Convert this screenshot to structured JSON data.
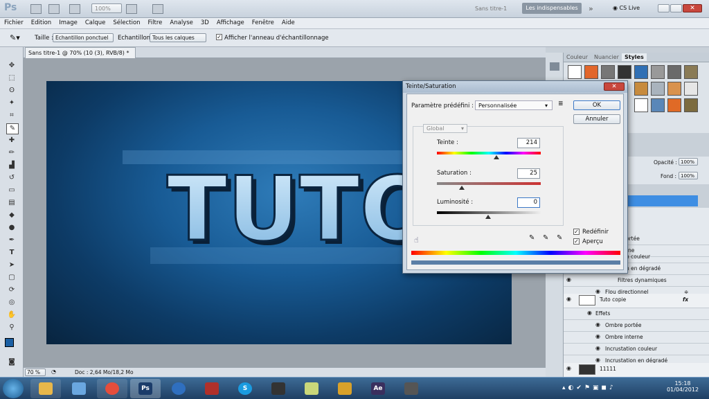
{
  "app": {
    "logo": "Ps",
    "zoom_combo": "100%",
    "doc_name_right": "Sans titre-1",
    "workspace": "Les indispensables",
    "cs_live": "CS Live",
    "more_icon": "»"
  },
  "menu": [
    "Fichier",
    "Edition",
    "Image",
    "Calque",
    "Sélection",
    "Filtre",
    "Analyse",
    "3D",
    "Affichage",
    "Fenêtre",
    "Aide"
  ],
  "options": {
    "size_label": "Taille :",
    "size_value": "Echantillon ponctuel",
    "sample_label": "Echantillon :",
    "sample_value": "Tous les calques",
    "ring_label": "Afficher l'anneau d'échantillonnage"
  },
  "document": {
    "tab_title": "Sans titre-1 @ 70% (10 (3), RVB/8) *",
    "canvas_text": "TUTO",
    "zoom": "70 %",
    "doc_info": "Doc : 2,64 Mo/18,2 Mo"
  },
  "panels": {
    "tabs": [
      "Couleur",
      "Nuancier",
      "Styles"
    ],
    "opacity_label": "Opacité :",
    "opacity_value": "100%",
    "fill_label": "Fond :",
    "fill_value": "100%"
  },
  "layers": [
    {
      "name": "ortée"
    },
    {
      "name": "rne"
    },
    {
      "name": "n couleur"
    },
    {
      "name": "n en dégradé"
    },
    {
      "name": "Filtres dynamiques"
    },
    {
      "name": "Flou directionnel"
    },
    {
      "name": "Tuto copie"
    },
    {
      "name": "Effets"
    },
    {
      "name": "Ombre portée"
    },
    {
      "name": "Ombre interne"
    },
    {
      "name": "Incrustation couleur"
    },
    {
      "name": "Incrustation en dégradé"
    },
    {
      "name": "11111"
    }
  ],
  "dialog": {
    "title": "Teinte/Saturation",
    "preset_label": "Paramètre prédéfini :",
    "preset_value": "Personnalisée",
    "ok": "OK",
    "cancel": "Annuler",
    "channel": "Global",
    "hue_label": "Teinte :",
    "hue_value": "214",
    "sat_label": "Saturation :",
    "sat_value": "25",
    "light_label": "Luminosité :",
    "light_value": "0",
    "colorize": "Redéfinir",
    "preview": "Aperçu"
  },
  "taskbar": {
    "apps": [
      "Explorateur",
      "Wacom",
      "Chrome",
      "Ps",
      "Internet",
      "Winrar",
      "Skype",
      "Camera",
      "Notes",
      "Lock",
      "Ae",
      "Tool"
    ],
    "time": "15:18",
    "date": "01/04/2012"
  },
  "colors": {
    "canvas_bg": "#185b95",
    "highlight": "#3e8ee3"
  }
}
